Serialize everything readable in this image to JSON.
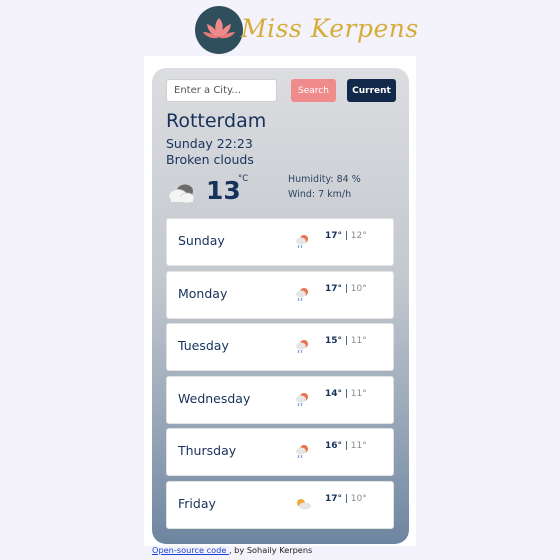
{
  "brand": {
    "name": "Miss Kerpens"
  },
  "search": {
    "placeholder": "Enter a City...",
    "value": ""
  },
  "buttons": {
    "search_label": "Search",
    "current_label": "Current"
  },
  "current": {
    "city": "Rotterdam",
    "datetime": "Sunday 22:23",
    "description": "Broken clouds",
    "temperature": "13",
    "unit": "°C",
    "humidity": "Humidity: 84 %",
    "wind": "Wind: 7 km/h",
    "icon": "broken-clouds-icon"
  },
  "forecast": [
    {
      "day": "Sunday",
      "max": "17°",
      "min": "12°",
      "icon": "rain-icon"
    },
    {
      "day": "Monday",
      "max": "17°",
      "min": "10°",
      "icon": "rain-icon"
    },
    {
      "day": "Tuesday",
      "max": "15°",
      "min": "11°",
      "icon": "rain-icon"
    },
    {
      "day": "Wednesday",
      "max": "14°",
      "min": "11°",
      "icon": "rain-icon"
    },
    {
      "day": "Thursday",
      "max": "16°",
      "min": "11°",
      "icon": "rain-icon"
    },
    {
      "day": "Friday",
      "max": "17°",
      "min": "10°",
      "icon": "sun-cloud-icon"
    }
  ],
  "footer": {
    "link_text": "Open-source code ",
    "by_text": ", by Sohaily Kerpens"
  },
  "colors": {
    "accent": "#ef8b8b",
    "navy": "#13294b",
    "logo_gold": "#d6ad3a"
  }
}
